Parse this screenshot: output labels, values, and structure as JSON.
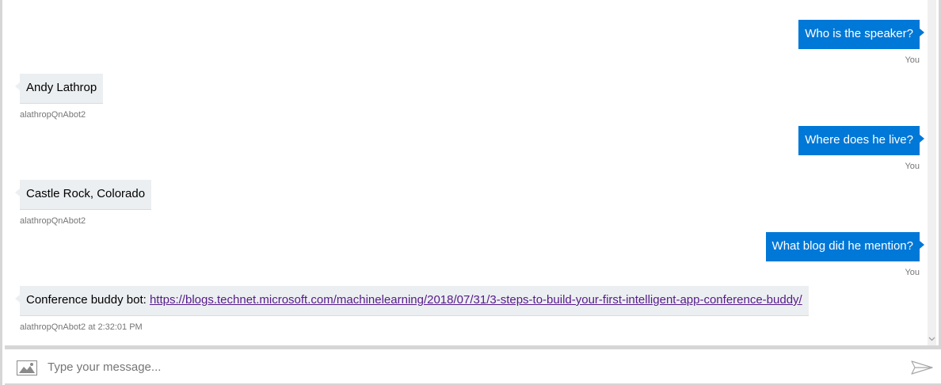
{
  "messages": [
    {
      "from": "user",
      "text": "Who is the speaker?",
      "meta": "You"
    },
    {
      "from": "bot",
      "text": "Andy Lathrop",
      "meta": "alathropQnAbot2"
    },
    {
      "from": "user",
      "text": "Where does he live?",
      "meta": "You"
    },
    {
      "from": "bot",
      "text": "Castle Rock, Colorado",
      "meta": "alathropQnAbot2"
    },
    {
      "from": "user",
      "text": "What blog did he mention?",
      "meta": "You"
    },
    {
      "from": "bot",
      "text": "Conference buddy bot: ",
      "link": "https://blogs.technet.microsoft.com/machinelearning/2018/07/31/3-steps-to-build-your-first-intelligent-app-conference-buddy/",
      "meta": "alathropQnAbot2 at 2:32:01 PM"
    }
  ],
  "composer": {
    "placeholder": "Type your message...",
    "upload_icon": "image-icon",
    "send_icon": "send-icon"
  },
  "colors": {
    "user_bubble": "#0078d7",
    "bot_bubble": "#eceff1",
    "link": "#551a8b"
  }
}
